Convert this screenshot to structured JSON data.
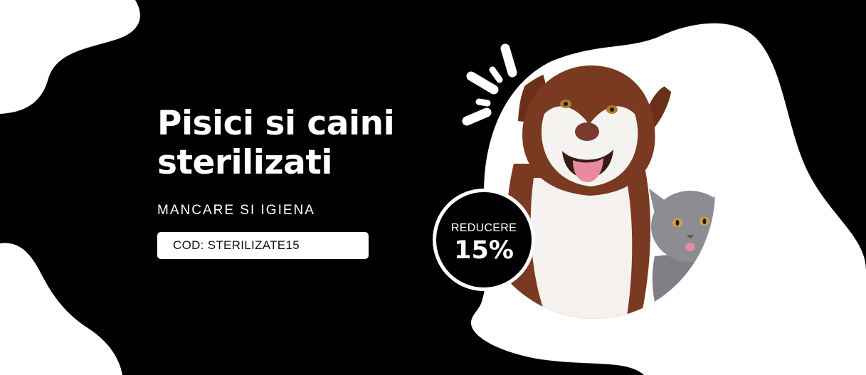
{
  "banner": {
    "headline_line1": "Pisici si caini",
    "headline_line2": "sterilizati",
    "subtitle": "MANCARE SI IGIENA",
    "promo_code": "COD: STERILIZATE15",
    "badge": {
      "label": "REDUCERE",
      "value": "15%"
    },
    "colors": {
      "background": "#000000",
      "foreground": "#ffffff",
      "dog_fur_brown": "#7a3a22",
      "cat_fur_grey": "#8c8c92"
    },
    "icons": [
      "sparkle-icon"
    ]
  }
}
